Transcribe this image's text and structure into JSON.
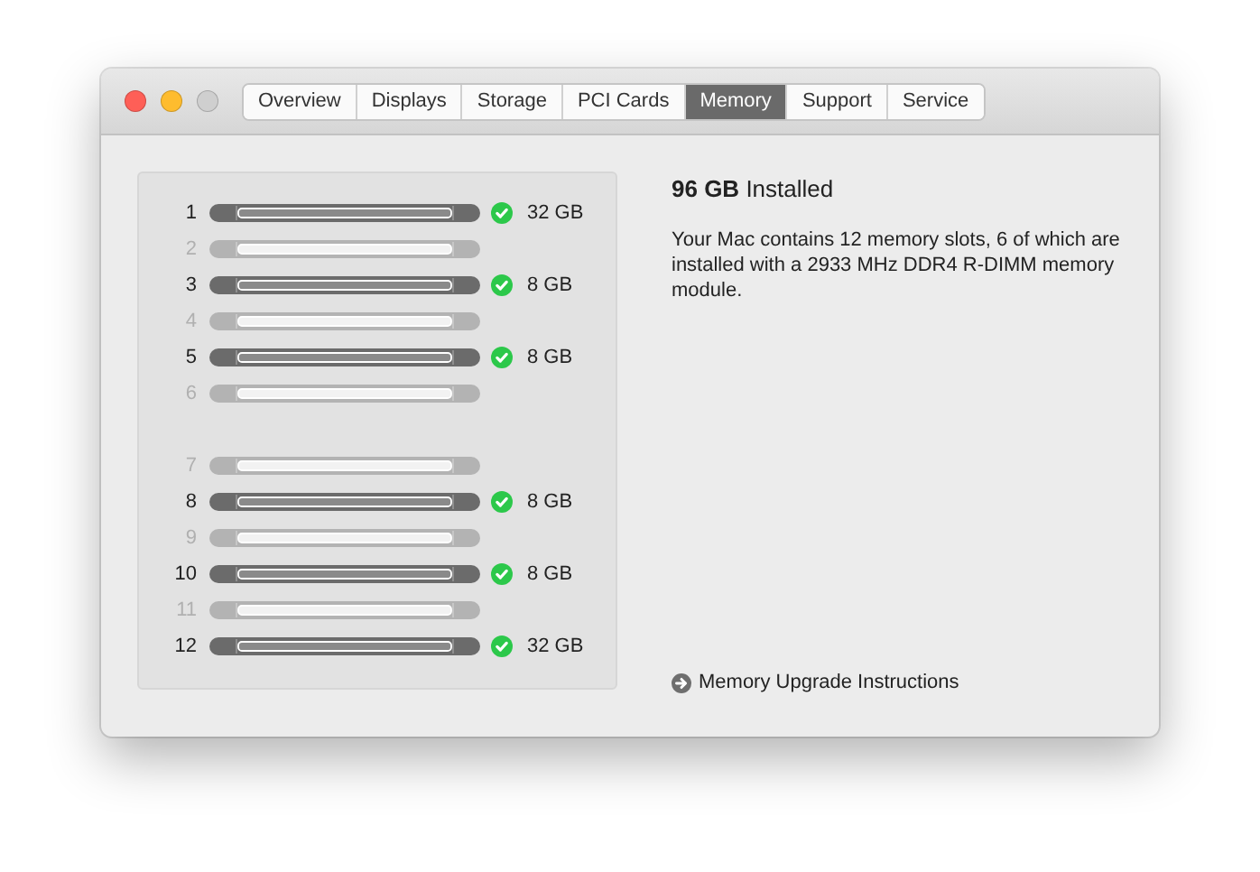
{
  "tabs": [
    {
      "label": "Overview",
      "selected": false
    },
    {
      "label": "Displays",
      "selected": false
    },
    {
      "label": "Storage",
      "selected": false
    },
    {
      "label": "PCI Cards",
      "selected": false
    },
    {
      "label": "Memory",
      "selected": true
    },
    {
      "label": "Support",
      "selected": false
    },
    {
      "label": "Service",
      "selected": false
    }
  ],
  "slot_groups": [
    [
      {
        "number": "1",
        "installed": true,
        "size": "32 GB"
      },
      {
        "number": "2",
        "installed": false
      },
      {
        "number": "3",
        "installed": true,
        "size": "8 GB"
      },
      {
        "number": "4",
        "installed": false
      },
      {
        "number": "5",
        "installed": true,
        "size": "8 GB"
      },
      {
        "number": "6",
        "installed": false
      }
    ],
    [
      {
        "number": "7",
        "installed": false
      },
      {
        "number": "8",
        "installed": true,
        "size": "8 GB"
      },
      {
        "number": "9",
        "installed": false
      },
      {
        "number": "10",
        "installed": true,
        "size": "8 GB"
      },
      {
        "number": "11",
        "installed": false
      },
      {
        "number": "12",
        "installed": true,
        "size": "32 GB"
      }
    ]
  ],
  "summary": {
    "headline": "**96 GB** Installed",
    "description": "Your Mac contains 12 memory slots, 6 of which are installed with a 2933 MHz DDR4 R-DIMM memory module."
  },
  "link": {
    "label": "Memory Upgrade Instructions"
  }
}
